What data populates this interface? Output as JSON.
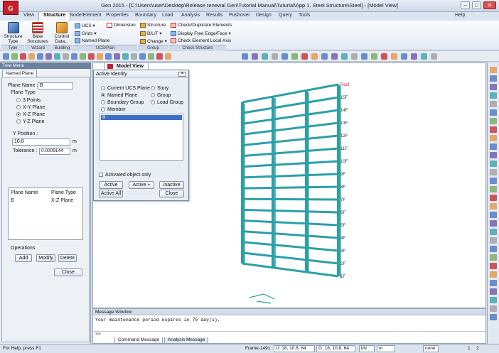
{
  "window": {
    "title": "Gen 2015 - [C:\\Users\\user\\Desktop\\Release renewal Gen\\Tutorial Manual\\Tuturial\\App 1. Steel Structure\\Steel] - [Model View]",
    "app_icon_text": "G"
  },
  "menu": {
    "items": [
      "View",
      "Structure",
      "Node/Element",
      "Properties",
      "Boundary",
      "Load",
      "Analysis",
      "Results",
      "Pushover",
      "Design",
      "Query",
      "Tools"
    ],
    "help": "Help"
  },
  "ribbon": {
    "structure_type": "Structure Type",
    "base_structures": "Base Structures",
    "control_data": "Control Data...",
    "ucs": "UCS",
    "grids": "Grids",
    "named_plane": "Named Plane",
    "dimension": "Dimension",
    "structure": "Structure",
    "blt": "B/L/T",
    "change": "Change",
    "check_dup": "Check/Duplicate Elements",
    "display_free": "Display Free Edge/Face",
    "check_local": "Check Element Local Axis",
    "groups": [
      "Type",
      "Wizard",
      "Building",
      "UCS/Plan",
      "Group",
      "Check Structure"
    ]
  },
  "tree_menu": {
    "header": "Tree Menu",
    "tab": "Named Plane",
    "plane_name_label": "Plane Name :",
    "plane_name_value": "B",
    "plane_type_label": "Plane Type",
    "plane_types": [
      "3 Points",
      "X-Y Plane",
      "X-Z Plane",
      "Y-Z Plane"
    ],
    "selected_type": "X-Z Plane",
    "y_position_label": "Y Position :",
    "y_position_value": "10.8",
    "y_unit": "m",
    "tolerance_label": "Tolerance :",
    "tolerance_value": "0.0009144",
    "tolerance_unit": "m",
    "list_headers": [
      "Plane Name",
      "Plane Type"
    ],
    "list_rows": [
      [
        "B",
        "X-Z Plane"
      ]
    ],
    "operations_label": "Operations",
    "add": "Add",
    "modify": "Modify",
    "delete": "Delete",
    "close": "Close"
  },
  "active_identity": {
    "title": "Active Identity",
    "options_left": [
      "Current UCS Plane",
      "Named Plane",
      "Boundary Group",
      "Member"
    ],
    "options_right": [
      "Story",
      "Group",
      "Load Group"
    ],
    "selected": "Named Plane",
    "list_item": "B",
    "checkbox_label": "Activated object only",
    "active": "Active",
    "active_plus": "Active +",
    "inactive": "Inactive",
    "active_all": "Active All",
    "close": "Close"
  },
  "model_view": {
    "tab": "Model View",
    "stories": [
      "Roof",
      "15F",
      "14F",
      "13F",
      "12F",
      "11F",
      "10F",
      "9F",
      "8F",
      "7F",
      "6F",
      "5F",
      "4F",
      "3F",
      "2F",
      "1F"
    ]
  },
  "message_window": {
    "header": "Message Window",
    "message": "Your maintenance period expires in 75 day(s).",
    "prompt": ">>",
    "tabs": [
      "Command Message",
      "Analysis Message"
    ]
  },
  "statusbar": {
    "help": "For Help, press F1",
    "frame": "Frame-1491",
    "u": "U: 18, 10.8, 64",
    "g": "G: 18, 10.8, 64",
    "unit_force": "kN",
    "unit_length": "m",
    "none": "none",
    "page": "1",
    "page_total": "2"
  },
  "colors": {
    "frame": "#2aa0a8",
    "accent": "#c8202a"
  }
}
